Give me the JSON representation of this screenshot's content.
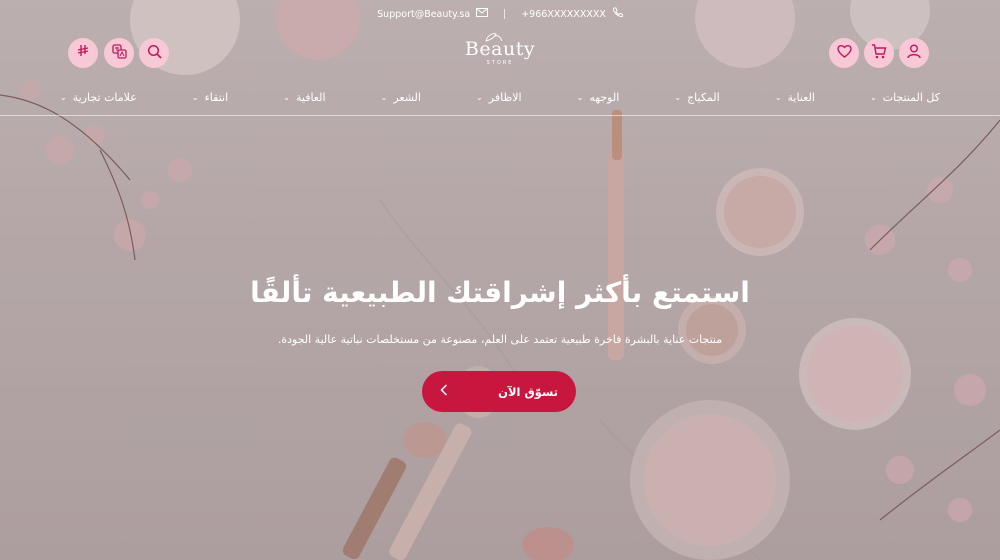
{
  "topbar": {
    "email": "Support@Beauty.sa",
    "phone": "+966XXXXXXXXX",
    "email_icon": "envelope-icon",
    "phone_icon": "phone-icon"
  },
  "logo": {
    "line1": "Beauty",
    "line2": "STORE"
  },
  "header_icons_left": [
    "currency-icon",
    "language-icon",
    "search-icon"
  ],
  "header_icons_right": [
    "heart-icon",
    "cart-icon",
    "user-icon"
  ],
  "nav": {
    "items": [
      {
        "label": "كل المنتجات"
      },
      {
        "label": "العناية"
      },
      {
        "label": "المكياج"
      },
      {
        "label": "الوجهه"
      },
      {
        "label": "الاظافر"
      },
      {
        "label": "الشعر"
      },
      {
        "label": "العافية"
      },
      {
        "label": "انتقاء"
      },
      {
        "label": "علامات تجارية"
      }
    ]
  },
  "hero": {
    "headline": "استمتع بأكثر إشراقتك الطبيعية تألقًا",
    "subtitle": "منتجات عناية بالبشرة فاخرة طبيعية تعتمد على العلم، مصنوعة من مستخلصات نباتية عالية الجودة.",
    "cta_label": "تسوّق الآن"
  },
  "colors": {
    "accent": "#c8173f",
    "icon_bg": "#f7c9d7",
    "icon_fg": "#c2185b"
  }
}
